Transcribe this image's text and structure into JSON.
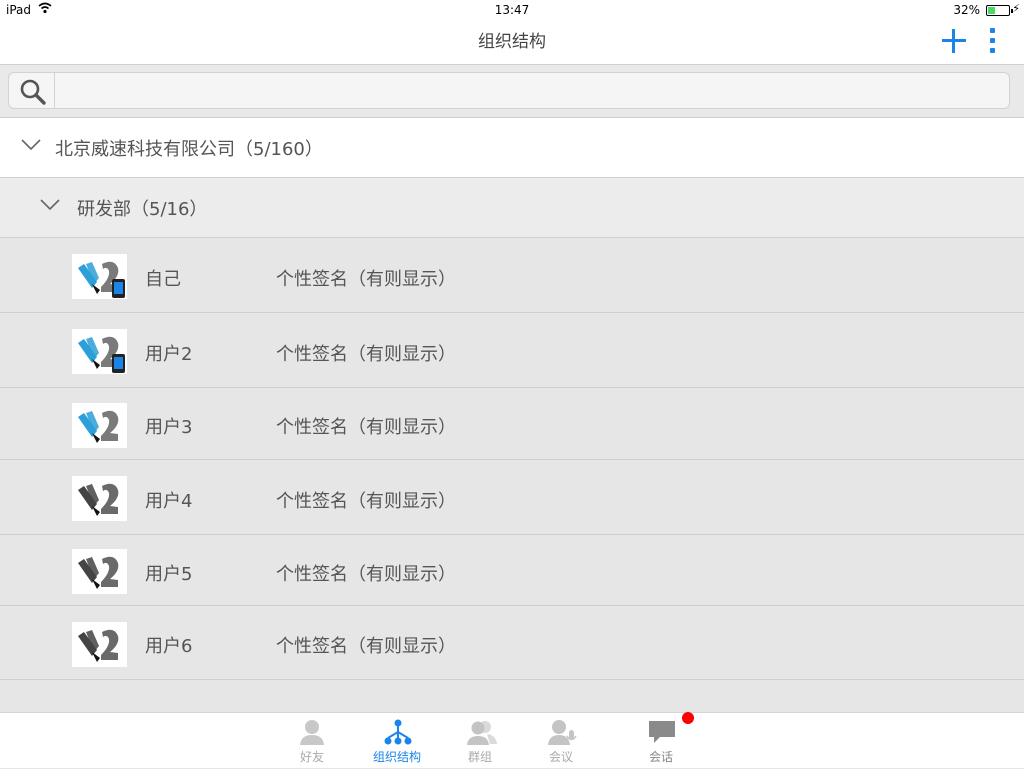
{
  "status_bar": {
    "device": "iPad",
    "time": "13:47",
    "battery": "32%",
    "battery_level": 0.32
  },
  "nav": {
    "title": "组织结构",
    "add_icon": "plus-icon",
    "more_icon": "more-vertical-icon"
  },
  "search": {
    "value": "",
    "placeholder": "",
    "icon": "search-icon"
  },
  "org": {
    "company_label": "北京威速科技有限公司（5/160）",
    "department_label": "研发部（5/16）"
  },
  "users": [
    {
      "name": "自己",
      "signature": "个性签名（有则显示）",
      "online": true,
      "mobile": true
    },
    {
      "name": "用户2",
      "signature": "个性签名（有则显示）",
      "online": true,
      "mobile": true
    },
    {
      "name": "用户3",
      "signature": "个性签名（有则显示）",
      "online": true,
      "mobile": false
    },
    {
      "name": "用户4",
      "signature": "个性签名（有则显示）",
      "online": false,
      "mobile": false
    },
    {
      "name": "用户5",
      "signature": "个性签名（有则显示）",
      "online": false,
      "mobile": false
    },
    {
      "name": "用户6",
      "signature": "个性签名（有则显示）",
      "online": false,
      "mobile": false
    }
  ],
  "tabs": [
    {
      "label": "好友",
      "icon": "friend-icon",
      "active": false
    },
    {
      "label": "组织结构",
      "icon": "org-structure-icon",
      "active": true
    },
    {
      "label": "群组",
      "icon": "group-icon",
      "active": false
    },
    {
      "label": "会议",
      "icon": "meeting-icon",
      "active": false
    },
    {
      "label": "会话",
      "icon": "chat-icon",
      "active": false,
      "badge": true
    }
  ],
  "colors": {
    "accent": "#1b84e8",
    "online_avatar": "#2a9fd8",
    "offline_avatar": "#444444",
    "badge": "#ff0000"
  }
}
